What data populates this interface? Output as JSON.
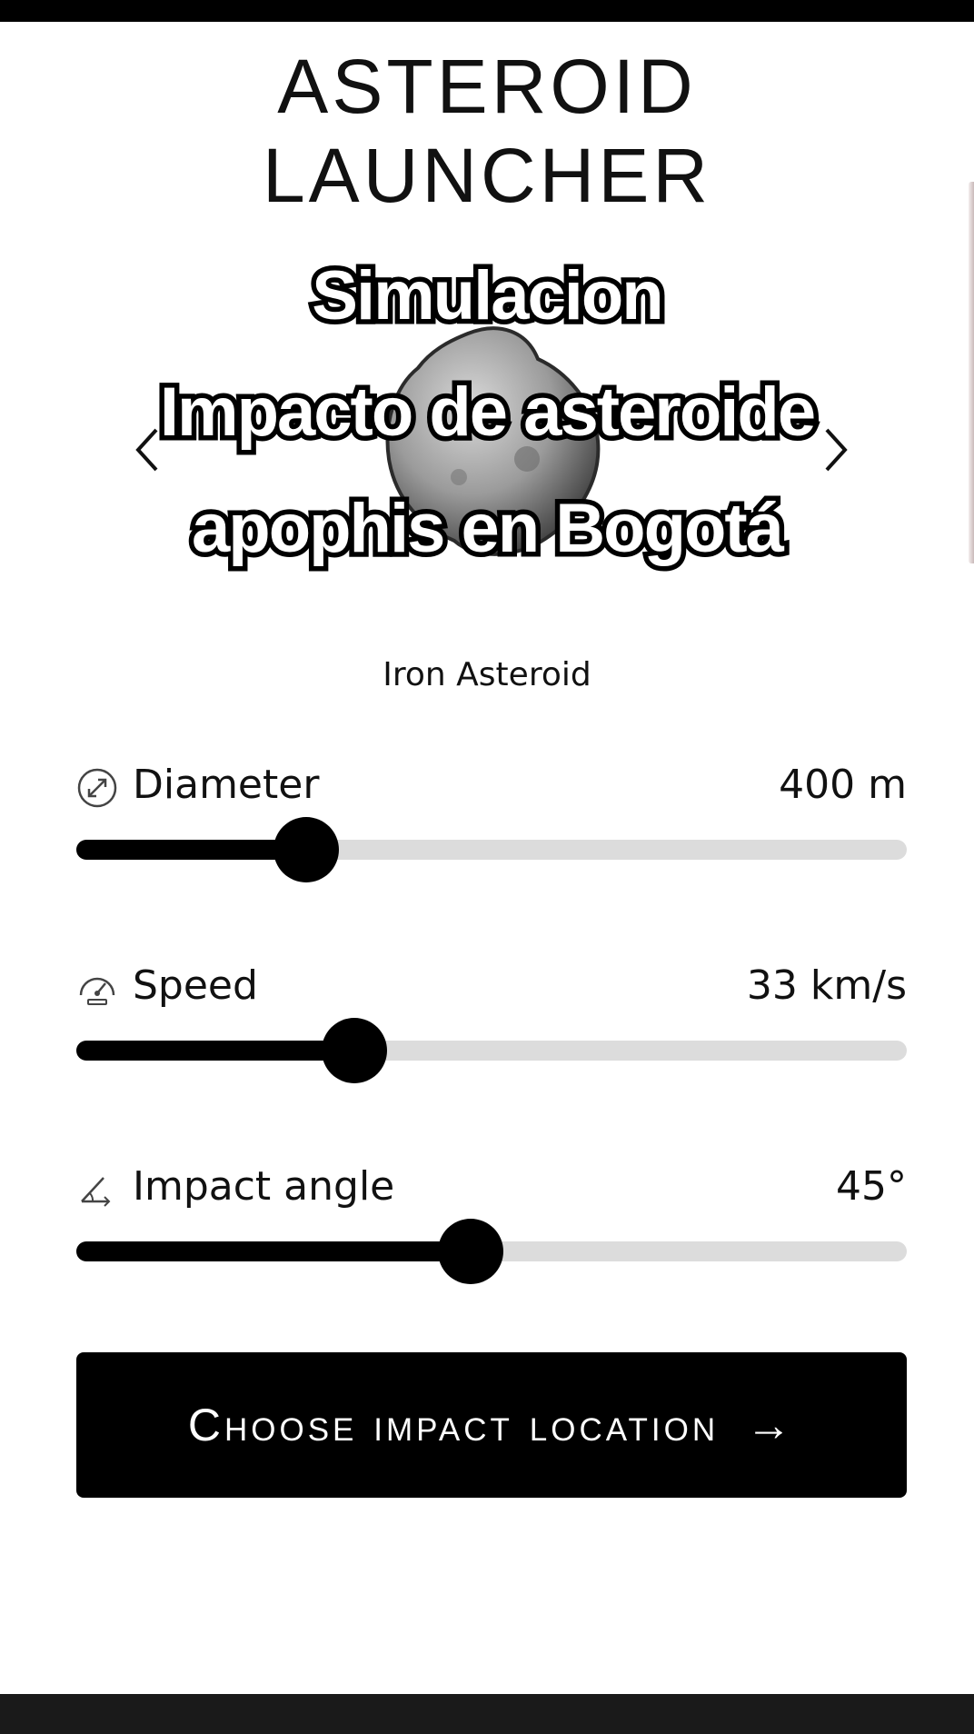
{
  "app": {
    "title_line1": "ASTEROID",
    "title_line2": "LAUNCHER"
  },
  "overlay_caption": {
    "line1": "Simulacion",
    "line2": "Impacto de asteroide",
    "line3": "apophis en Bogotá"
  },
  "asteroid": {
    "type_label": "Iron Asteroid",
    "icon": "asteroid-rock"
  },
  "carousel": {
    "prev_icon": "chevron-left-icon",
    "next_icon": "chevron-right-icon"
  },
  "controls": {
    "diameter": {
      "label": "Diameter",
      "value": "400 m",
      "level": 0.277,
      "icon": "diameter-arrow-icon"
    },
    "speed": {
      "label": "Speed",
      "value": "33 km/s",
      "level": 0.335,
      "icon": "speedometer-icon"
    },
    "angle": {
      "label": "Impact angle",
      "value": "45°",
      "level": 0.475,
      "icon": "angle-icon"
    }
  },
  "cta": {
    "label": "Choose impact location",
    "arrow": "→"
  },
  "colors": {
    "accent": "#000000",
    "track": "#dcdcdc",
    "background": "#ffffff"
  }
}
